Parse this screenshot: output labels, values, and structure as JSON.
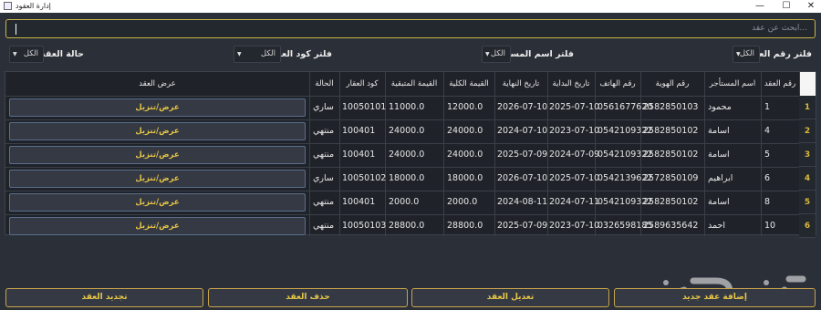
{
  "window": {
    "title": "إدارة العقود",
    "minimize": "—",
    "maximize": "☐",
    "close": "✕"
  },
  "search": {
    "placeholder": "ابحث عن عقد..."
  },
  "filters": [
    {
      "label": "فلتر رقم العقد:",
      "value": "الكل"
    },
    {
      "label": "فلتر اسم المستأجر:",
      "value": "الكل"
    },
    {
      "label": "فلتر كود العقار:",
      "value": "الكل"
    },
    {
      "label": "حالة العقد:",
      "value": "الكل"
    }
  ],
  "table": {
    "columns": [
      "رقم العقد",
      "اسم المستأجر",
      "رقم الهوية",
      "رقم الهاتف",
      "تاريخ البداية",
      "تاريخ النهاية",
      "القيمة الكلية",
      "القيمة المتبقية",
      "كود العقار",
      "الحالة",
      "عرض العقد"
    ],
    "rows": [
      {
        "num": "1",
        "contract": "1",
        "tenant": "محمود",
        "id": "2582850103",
        "phone": "0561677620",
        "start": "2025-07-10",
        "end": "2026-07-10",
        "total": "12000.0",
        "remaining": "11000.0",
        "code": "10050101",
        "status": "ساري",
        "action": "عرض/تنزيل"
      },
      {
        "num": "2",
        "contract": "4",
        "tenant": "اسامة",
        "id": "2582850102",
        "phone": "0542109322",
        "start": "2023-07-10",
        "end": "2024-07-10",
        "total": "24000.0",
        "remaining": "24000.0",
        "code": "100401",
        "status": "منتهي",
        "action": "عرض/تنزيل"
      },
      {
        "num": "3",
        "contract": "5",
        "tenant": "اسامة",
        "id": "2582850102",
        "phone": "0542109322",
        "start": "2024-07-09",
        "end": "2025-07-09",
        "total": "24000.0",
        "remaining": "24000.0",
        "code": "100401",
        "status": "منتهي",
        "action": "عرض/تنزيل"
      },
      {
        "num": "4",
        "contract": "6",
        "tenant": "ابراهيم",
        "id": "2572850109",
        "phone": "0542139622",
        "start": "2025-07-10",
        "end": "2026-07-10",
        "total": "18000.0",
        "remaining": "18000.0",
        "code": "10050102",
        "status": "ساري",
        "action": "عرض/تنزيل"
      },
      {
        "num": "5",
        "contract": "8",
        "tenant": "اسامة",
        "id": "2582850102",
        "phone": "0542109322",
        "start": "2024-07-11",
        "end": "2024-08-11",
        "total": "2000.0",
        "remaining": "2000.0",
        "code": "100401",
        "status": "منتهي",
        "action": "عرض/تنزيل"
      },
      {
        "num": "6",
        "contract": "10",
        "tenant": "احمد",
        "id": "2589635642",
        "phone": "0326598185",
        "start": "2023-07-10",
        "end": "2025-07-09",
        "total": "28800.0",
        "remaining": "28800.0",
        "code": "10050103",
        "status": "منتهي",
        "action": "عرض/تنزيل"
      }
    ]
  },
  "bottom_buttons": {
    "add": "إضافة عقد جديد",
    "edit": "تعديل العقد",
    "delete": "حذف العقد",
    "renew": "تجديد العقد"
  },
  "watermark": {
    "text": "حراج"
  },
  "colors": {
    "accent": "#e7c645",
    "background": "#2b2f37",
    "border": "#caa54a"
  }
}
